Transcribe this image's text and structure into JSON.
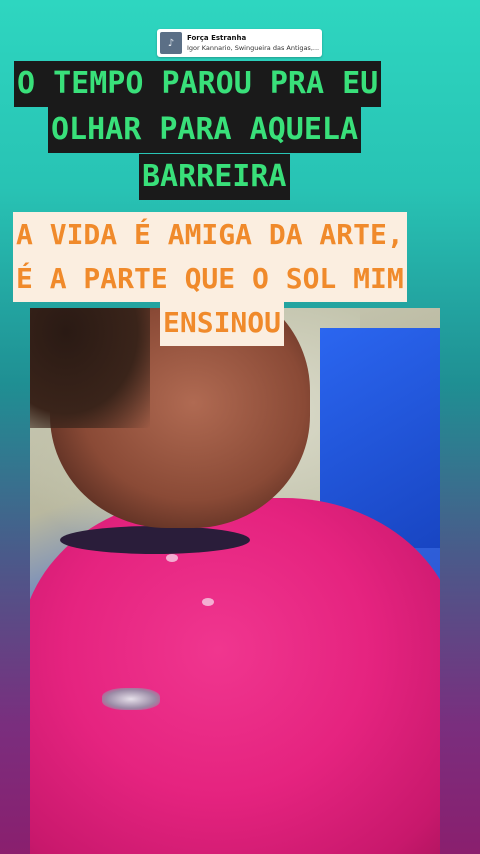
{
  "music": {
    "thumb_icon": "album-art-icon",
    "title": "Força Estranha",
    "artist": "Igor Kannario, Swingueira das Antigas,..."
  },
  "captions": {
    "dark": [
      "O TEMPO PAROU PRA EU",
      "OLHAR PARA AQUELA",
      "BARREIRA"
    ],
    "light": [
      "A VIDA É AMIGA DA ARTE,",
      "É A PARTE QUE O SOL MIM",
      "ENSINOU"
    ]
  },
  "colors": {
    "dark_caption_bg": "#1a1a1a",
    "dark_caption_text": "#39e07a",
    "light_caption_bg": "#fbeee0",
    "light_caption_text": "#f08a2b"
  }
}
